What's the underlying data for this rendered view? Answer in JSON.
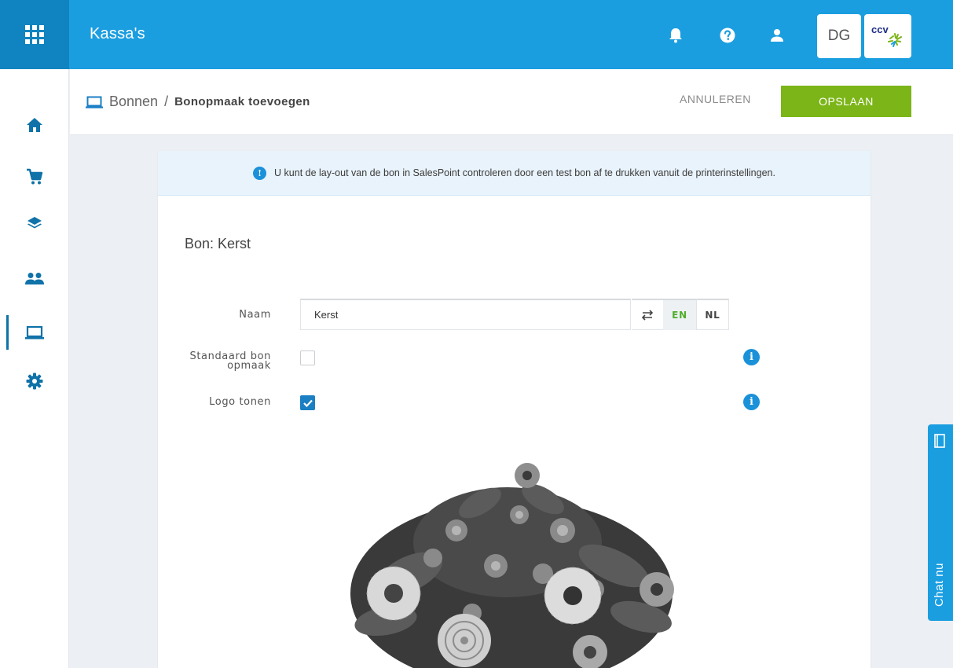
{
  "topbar": {
    "title": "Kassa's",
    "user_initials": "DG",
    "brand_logo_text": "ccv",
    "icons": [
      "apps-grid-icon",
      "bell-icon",
      "help-icon",
      "user-icon"
    ]
  },
  "sidebar": {
    "items": [
      {
        "name": "home",
        "icon": "home-icon"
      },
      {
        "name": "cart",
        "icon": "cart-icon"
      },
      {
        "name": "layers",
        "icon": "layers-icon"
      },
      {
        "name": "users",
        "icon": "users-icon"
      },
      {
        "name": "laptop",
        "icon": "laptop-icon",
        "active": true
      },
      {
        "name": "settings",
        "icon": "gear-icon"
      }
    ]
  },
  "header": {
    "breadcrumb_parent": "Bonnen",
    "breadcrumb_separator": "/",
    "breadcrumb_current": "Bonopmaak toevoegen",
    "cancel_label": "ANNULEREN",
    "save_label": "OPSLAAN"
  },
  "banner": {
    "message": "U kunt de lay-out van de bon in SalesPoint controleren door een test bon af te drukken vanuit de printerinstellingen."
  },
  "form": {
    "title": "Bon: Kerst",
    "name_label": "Naam",
    "name_value": "Kerst",
    "languages": [
      "EN",
      "NL"
    ],
    "active_language": "EN",
    "default_label_line1": "Standaard bon",
    "default_label_line2": "opmaak",
    "default_checked": false,
    "logo_label": "Logo tonen",
    "logo_checked": true
  },
  "chat": {
    "label": "Chat nu"
  },
  "colors": {
    "topbar": "#1b9ee0",
    "apps_tile": "#0f84c0",
    "save_button": "#7cb518",
    "accent_blue": "#1b7fc4",
    "sidebar_icon": "#0f72a8",
    "active_language": "#4fae2b"
  }
}
